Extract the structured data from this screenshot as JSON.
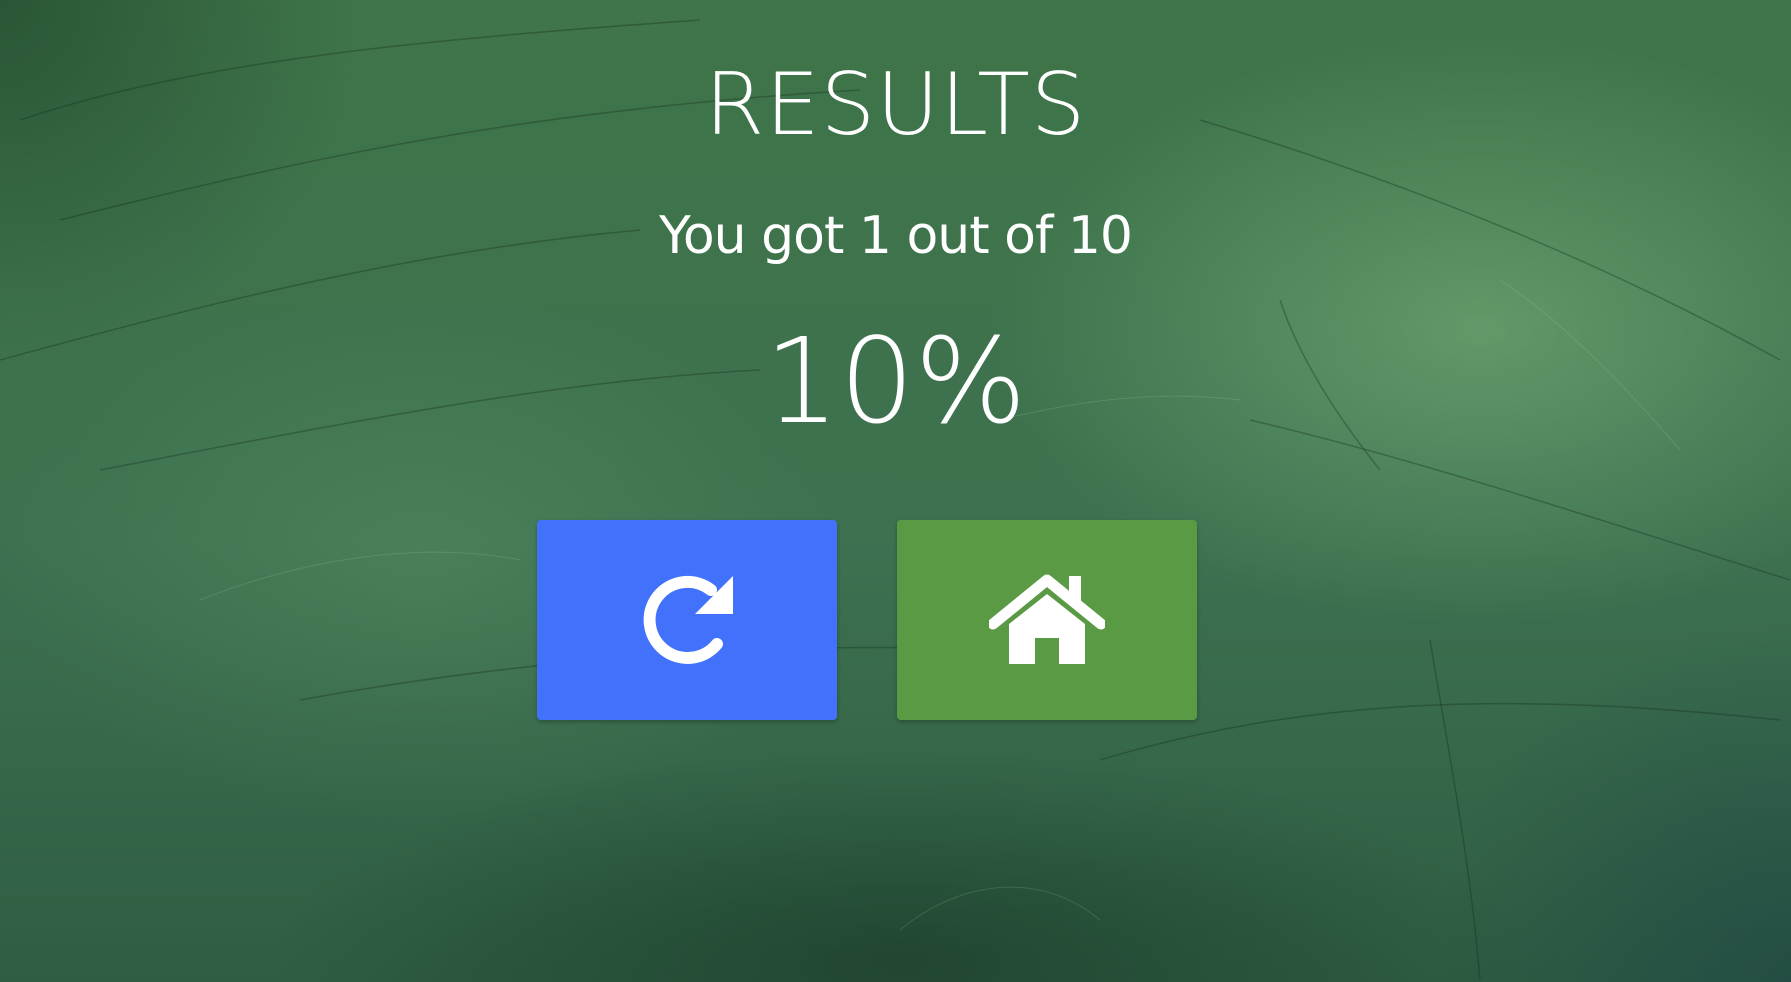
{
  "results": {
    "title": "RESULTS",
    "score_text": "You got 1 out of 10",
    "percent_text": "10%",
    "correct": 1,
    "total": 10,
    "percent": 10
  },
  "actions": {
    "retry": {
      "icon": "redo-icon",
      "color": "#4271fb"
    },
    "home": {
      "icon": "home-icon",
      "color": "#5a9a44"
    }
  },
  "theme": {
    "background": "green chalkboard texture",
    "text_color": "#ffffff"
  }
}
